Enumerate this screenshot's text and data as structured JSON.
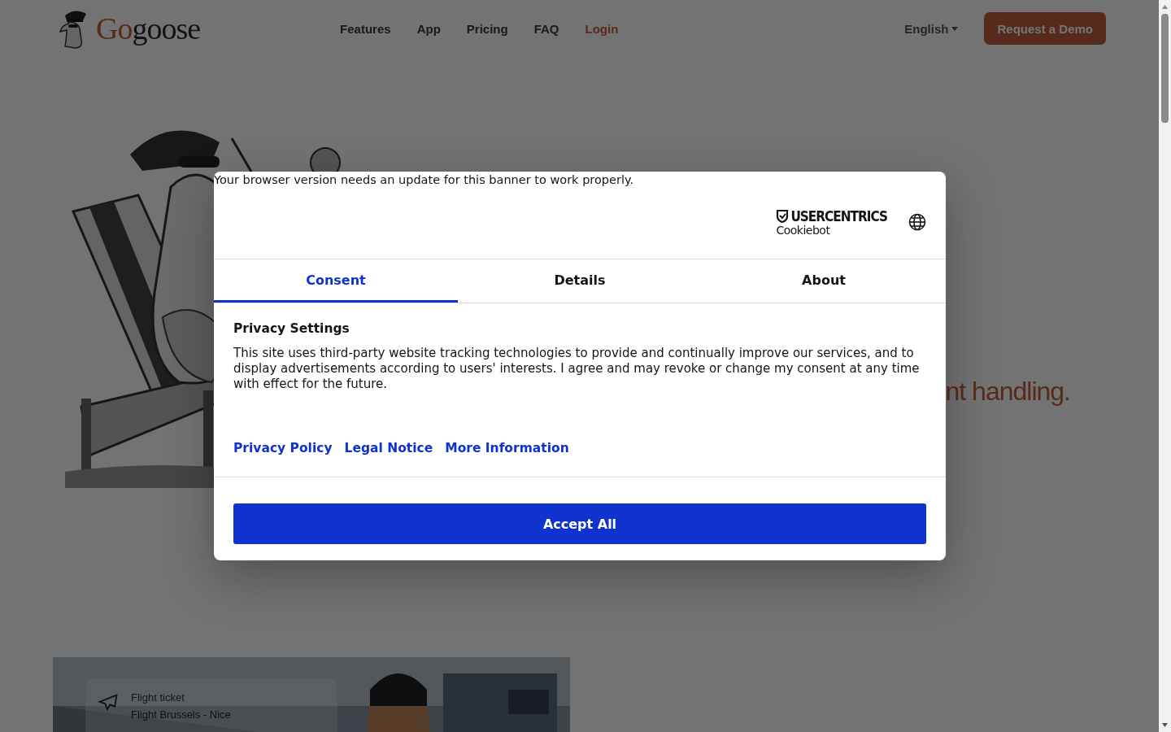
{
  "header": {
    "logo": {
      "accent": "Go",
      "rest": "goose"
    },
    "nav": [
      {
        "label": "Features",
        "kind": "link"
      },
      {
        "label": "App",
        "kind": "link"
      },
      {
        "label": "Pricing",
        "kind": "link"
      },
      {
        "label": "FAQ",
        "kind": "link"
      },
      {
        "label": "Login",
        "kind": "accent"
      }
    ],
    "language": "English",
    "cta": "Request a Demo"
  },
  "hero": {
    "headline": "nt handling."
  },
  "media_card": {
    "title": "Flight ticket",
    "subtitle": "Flight Brussels - Nice"
  },
  "consent_dialog": {
    "notice": "Your browser version needs an update for this banner to work properly.",
    "brand": {
      "name": "USERCENTRICS",
      "product": "Cookiebot"
    },
    "tabs": [
      {
        "label": "Consent",
        "selected": true
      },
      {
        "label": "Details",
        "selected": false
      },
      {
        "label": "About",
        "selected": false
      }
    ],
    "heading": "Privacy Settings",
    "body": "This site uses third-party website tracking technologies to provide and continually improve our services, and to display advertisements according to users' interests. I agree and may revoke or change my consent at any time with effect for the future.",
    "links": [
      "Privacy Policy",
      "Legal Notice",
      "More Information"
    ],
    "accept_button": "Accept All"
  }
}
